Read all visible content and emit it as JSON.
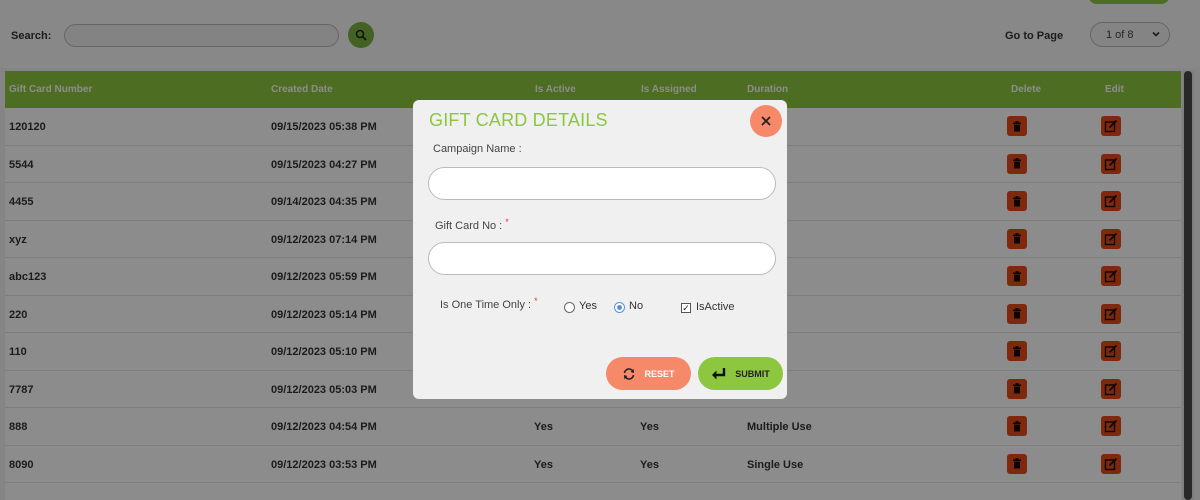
{
  "search": {
    "label": "Search:",
    "value": ""
  },
  "pagination": {
    "label": "Go to Page",
    "current": "1 of 8"
  },
  "table": {
    "columns": [
      "Gift Card Number",
      "Created Date",
      "Is Active",
      "Is Assigned",
      "Duration",
      "Delete",
      "Edit"
    ],
    "rows": [
      {
        "number": "120120",
        "date": "09/15/2023 05:38 PM",
        "active": "",
        "assigned": "",
        "duration": "Use"
      },
      {
        "number": "5544",
        "date": "09/15/2023 04:27 PM",
        "active": "",
        "assigned": "",
        "duration": "e Use"
      },
      {
        "number": "4455",
        "date": "09/14/2023 04:35 PM",
        "active": "",
        "assigned": "",
        "duration": "Use"
      },
      {
        "number": "xyz",
        "date": "09/12/2023 07:14 PM",
        "active": "",
        "assigned": "",
        "duration": "Use"
      },
      {
        "number": "abc123",
        "date": "09/12/2023 05:59 PM",
        "active": "",
        "assigned": "",
        "duration": "e Use"
      },
      {
        "number": "220",
        "date": "09/12/2023 05:14 PM",
        "active": "",
        "assigned": "",
        "duration": "e Use"
      },
      {
        "number": "110",
        "date": "09/12/2023 05:10 PM",
        "active": "",
        "assigned": "",
        "duration": "Use"
      },
      {
        "number": "7787",
        "date": "09/12/2023 05:03 PM",
        "active": "",
        "assigned": "",
        "duration": "e Use"
      },
      {
        "number": "888",
        "date": "09/12/2023 04:54 PM",
        "active": "Yes",
        "assigned": "Yes",
        "duration": "Multiple Use"
      },
      {
        "number": "8090",
        "date": "09/12/2023 03:53 PM",
        "active": "Yes",
        "assigned": "Yes",
        "duration": "Single Use"
      }
    ]
  },
  "modal": {
    "title": "GIFT CARD DETAILS",
    "campaign_label": "Campaign  Name :",
    "campaign_value": "",
    "gift_card_label": "Gift Card No :",
    "gift_card_value": "",
    "required_mark": "*",
    "one_time_label": "Is One Time Only  :",
    "option_yes": "Yes",
    "option_no": "No",
    "isactive_label": "IsActive",
    "isactive_checked": true,
    "selected_option": "No",
    "reset_label": "RESET",
    "submit_label": "SUBMIT"
  },
  "colors": {
    "brand_green": "#8dc63f",
    "danger": "#e64a19",
    "salmon": "#f58969",
    "radio_blue": "#5b8fdb"
  }
}
